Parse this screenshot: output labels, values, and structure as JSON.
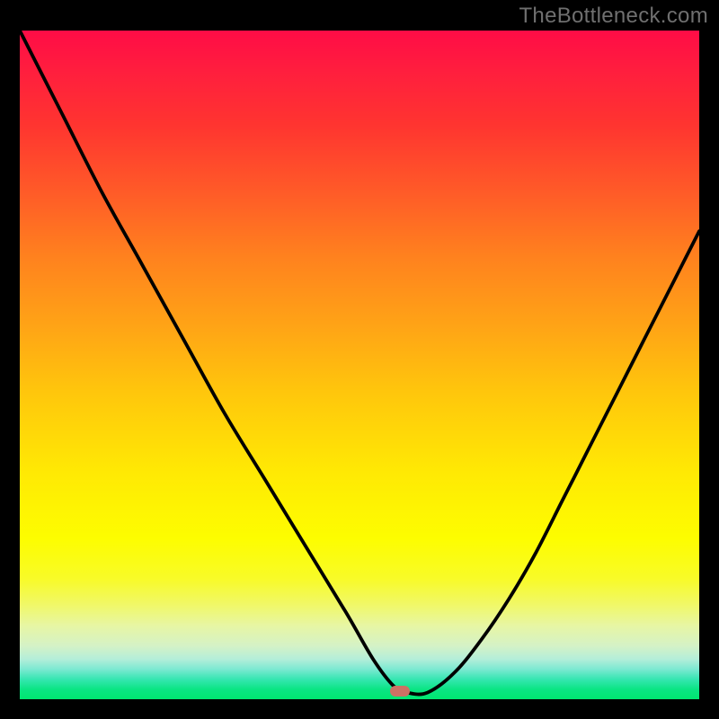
{
  "watermark": "TheBottleneck.com",
  "marker": {
    "x_frac": 0.56,
    "y_frac": 0.988
  },
  "chart_data": {
    "type": "line",
    "title": "",
    "xlabel": "",
    "ylabel": "",
    "xlim": [
      0,
      100
    ],
    "ylim": [
      0,
      100
    ],
    "grid": false,
    "legend": false,
    "series": [
      {
        "name": "curve",
        "x": [
          0,
          6,
          12,
          18,
          24,
          30,
          36,
          42,
          48,
          52,
          55,
          57,
          60,
          64,
          68,
          72,
          76,
          80,
          84,
          88,
          92,
          96,
          100
        ],
        "y": [
          100,
          88,
          76,
          65,
          54,
          43,
          33,
          23,
          13,
          6,
          2,
          1,
          1,
          4,
          9,
          15,
          22,
          30,
          38,
          46,
          54,
          62,
          70
        ]
      }
    ],
    "annotations": [
      {
        "name": "marker",
        "x": 56,
        "y": 1.2,
        "color": "#cd7164"
      }
    ]
  }
}
